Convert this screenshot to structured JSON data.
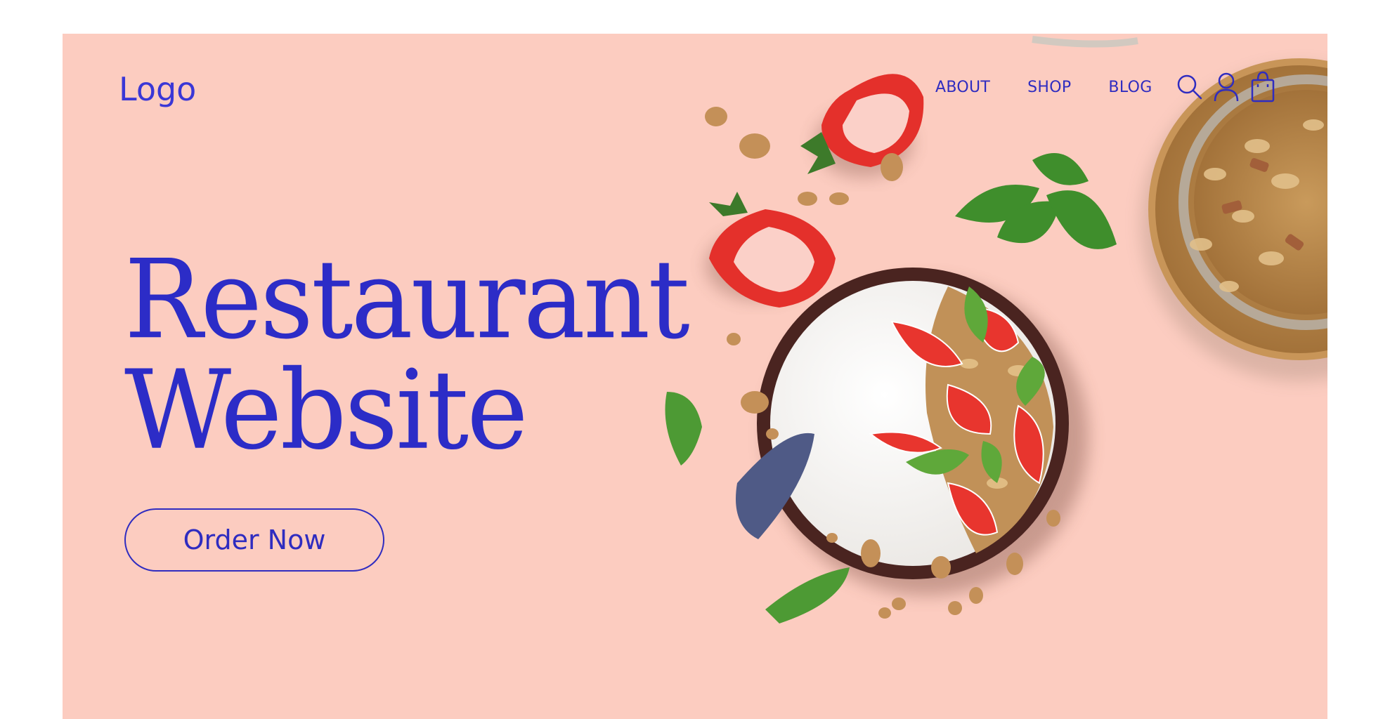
{
  "header": {
    "logo": "Logo",
    "nav": [
      {
        "label": "ABOUT"
      },
      {
        "label": "SHOP"
      },
      {
        "label": "BLOG"
      }
    ],
    "icons": [
      "search-icon",
      "user-icon",
      "shopping-bag-icon"
    ]
  },
  "hero": {
    "title_line1": "Restaurant",
    "title_line2": "Website",
    "cta_label": "Order Now",
    "image": "granola-yogurt-bowl-with-strawberries-and-mint"
  },
  "colors": {
    "background": "#fcccc0",
    "accent": "#2f2cc0",
    "page": "#ffffff"
  }
}
